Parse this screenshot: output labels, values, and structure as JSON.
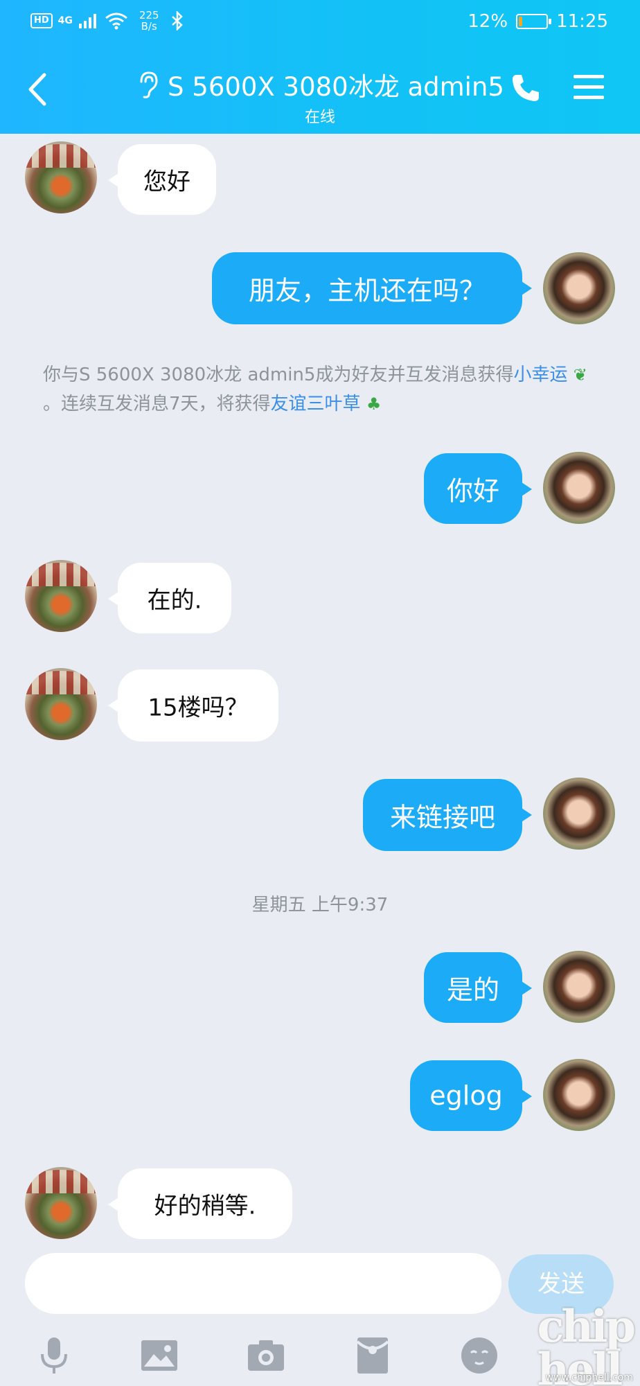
{
  "status_bar": {
    "hd": "HD",
    "network": "4G",
    "speed_value": "225",
    "speed_unit": "B/s",
    "battery": "12%",
    "battery_level": 0.12,
    "time": "11:25"
  },
  "header": {
    "title": "S 5600X 3080冰龙 admin5",
    "status": "在线",
    "icons": [
      "back-icon",
      "ear-icon",
      "phone-icon",
      "menu-icon"
    ]
  },
  "messages": [
    {
      "from": "them",
      "text": "您好"
    },
    {
      "from": "me",
      "text": "朋友，主机还在吗？"
    },
    {
      "from": "me",
      "text": "你好"
    },
    {
      "from": "them",
      "text": "在的."
    },
    {
      "from": "them",
      "text": "15楼吗？"
    },
    {
      "from": "me",
      "text": "来链接吧"
    },
    {
      "from": "me",
      "text": "是的"
    },
    {
      "from": "me",
      "text": "eglog"
    },
    {
      "from": "them",
      "text": "好的稍等."
    }
  ],
  "system_notice": {
    "part1": "你与S 5600X 3080冰龙 admin5成为好友并互发消息获得",
    "link1": "小幸运",
    "part2": "。连续互发消息7天，将获得",
    "link2": "友谊三叶草"
  },
  "timestamp": "星期五 上午9:37",
  "input": {
    "value": "",
    "send_label": "发送"
  },
  "toolbar": [
    "mic-icon",
    "image-icon",
    "camera-icon",
    "red-packet-icon",
    "emoji-icon"
  ],
  "watermark": {
    "logo": "chip hell",
    "url": "www.chiphell.com"
  },
  "colors": {
    "header": "#12c2f6",
    "my_bubble": "#1cabf6",
    "their_bubble": "#ffffff",
    "background": "#e9edf3",
    "link": "#3b8ee8"
  }
}
